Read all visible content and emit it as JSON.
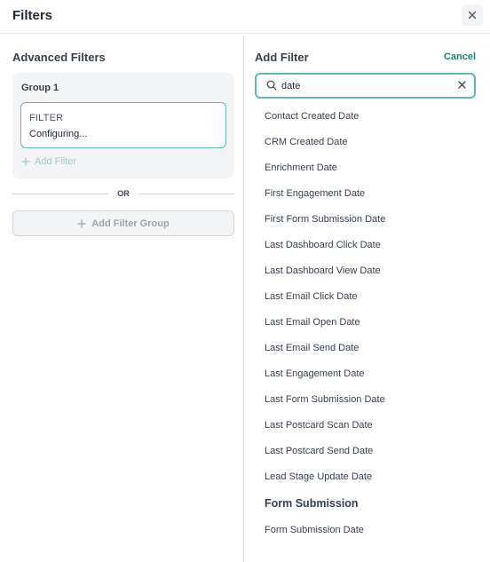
{
  "header": {
    "title": "Filters"
  },
  "left": {
    "title": "Advanced Filters",
    "group": {
      "label": "Group 1",
      "filter_label": "FILTER",
      "filter_status": "Configuring...",
      "add_filter_label": "Add Filter"
    },
    "or_label": "OR",
    "add_group_label": "Add Filter Group"
  },
  "right": {
    "title": "Add Filter",
    "cancel_label": "Cancel",
    "search": {
      "value": "date",
      "placeholder": ""
    },
    "options": [
      "Contact Created Date",
      "CRM Created Date",
      "Enrichment Date",
      "First Engagement Date",
      "First Form Submission Date",
      "Last Dashboard Click Date",
      "Last Dashboard View Date",
      "Last Email Click Date",
      "Last Email Open Date",
      "Last Email Send Date",
      "Last Engagement Date",
      "Last Form Submission Date",
      "Last Postcard Scan Date",
      "Last Postcard Send Date",
      "Lead Stage Update Date"
    ],
    "section_header": "Form Submission",
    "section_options": [
      "Form Submission Date"
    ]
  },
  "colors": {
    "accent": "#1a7f78",
    "accent_border": "#5fb8b1",
    "muted_accent": "#9ccfca"
  },
  "icons": {
    "close": "close-icon",
    "search": "search-icon",
    "clear": "clear-icon",
    "plus": "plus-icon"
  }
}
